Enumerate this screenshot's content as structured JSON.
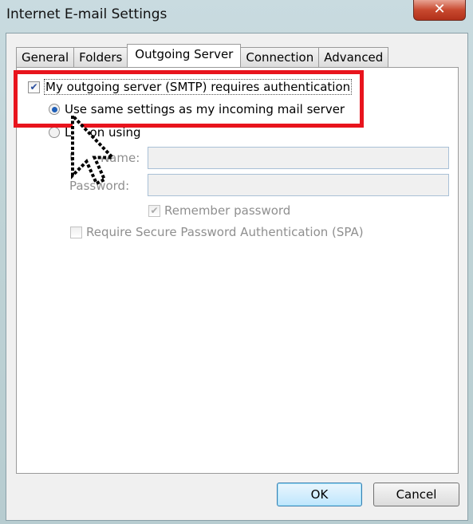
{
  "window": {
    "title": "Internet E-mail Settings",
    "close_icon": "close-icon"
  },
  "tabs": [
    {
      "label": "General"
    },
    {
      "label": "Folders"
    },
    {
      "label": "Outgoing Server",
      "active": true
    },
    {
      "label": "Connection"
    },
    {
      "label": "Advanced"
    }
  ],
  "outgoing": {
    "requires_auth_label": "My outgoing server (SMTP) requires authentication",
    "requires_auth_checked": true,
    "use_same_label": "Use same settings as my incoming mail server",
    "use_same_selected": true,
    "log_on_label": "Log on using",
    "log_on_selected": false,
    "user_name_label": "User Name:",
    "user_name_value": "",
    "password_label": "Password:",
    "password_value": "",
    "remember_password_label": "Remember password",
    "remember_password_checked": true,
    "spa_label": "Require Secure Password Authentication (SPA)",
    "spa_checked": false
  },
  "buttons": {
    "ok": "OK",
    "cancel": "Cancel"
  },
  "highlight_color": "#e8141d"
}
